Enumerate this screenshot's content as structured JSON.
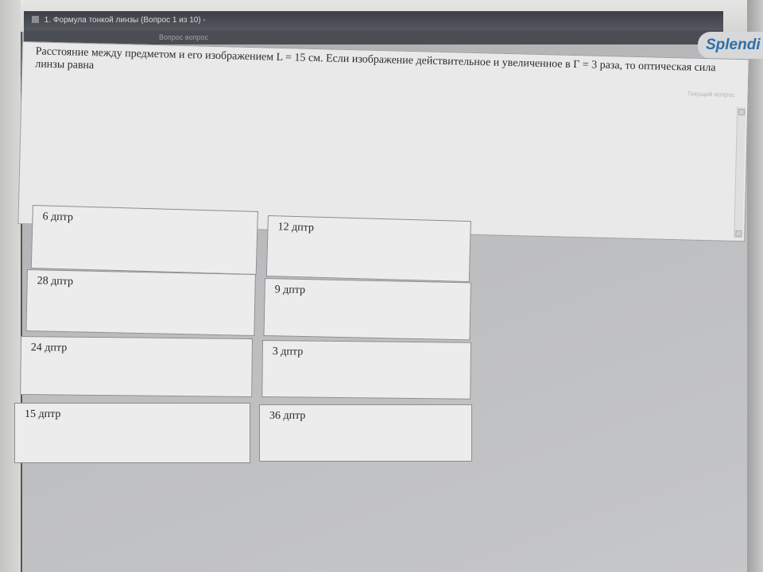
{
  "window": {
    "title": "1. Формула тонкой линзы (Вопрос 1 из 10) -",
    "toolbar_text": "Вопрос вопрос"
  },
  "brand": {
    "name": "Splendi"
  },
  "question": {
    "text": "Расстояние между предметом и его изображением L = 15 см. Если изображение действительное и увеличенное в Г = 3 раза, то оптическая сила линзы равна",
    "hint": "Текущий вопрос"
  },
  "answers": [
    {
      "label": "6 дптр"
    },
    {
      "label": "12 дптр"
    },
    {
      "label": "28 дптр"
    },
    {
      "label": "9 дптр"
    },
    {
      "label": "24 дптр"
    },
    {
      "label": "3 дптр"
    },
    {
      "label": "15 дптр"
    },
    {
      "label": "36 дптр"
    }
  ],
  "colors": {
    "screen_background": "#b9babc",
    "panel_background": "#e9e9ea",
    "answer_background": "#ececed",
    "titlebar": "#3c4046"
  }
}
